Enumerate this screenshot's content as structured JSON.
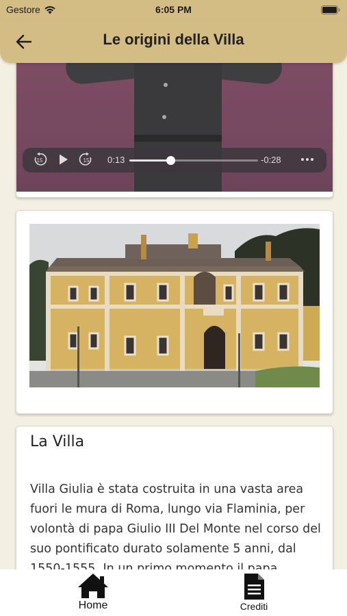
{
  "status_bar": {
    "carrier": "Gestore",
    "time": "6:05 PM"
  },
  "header": {
    "title": "Le origini della Villa"
  },
  "video": {
    "current_time": "0:13",
    "remaining_time": "-0:28",
    "progress": 0.32,
    "skip_seconds": "15"
  },
  "section": {
    "title": "La Villa",
    "body": "Villa Giulia è stata costruita in una vasta area fuori le mura di Roma, lungo via Flaminia, per volontà di papa Giulio III Del Monte nel corso del suo pontificato durato solamente 5 anni, dal 1550-1555. In un primo momento il papa"
  },
  "tabs": [
    {
      "label": "Home",
      "icon": "home-icon"
    },
    {
      "label": "Crediti",
      "icon": "document-icon"
    }
  ],
  "colors": {
    "header": "#d4bd84",
    "background": "#f4efe3"
  }
}
